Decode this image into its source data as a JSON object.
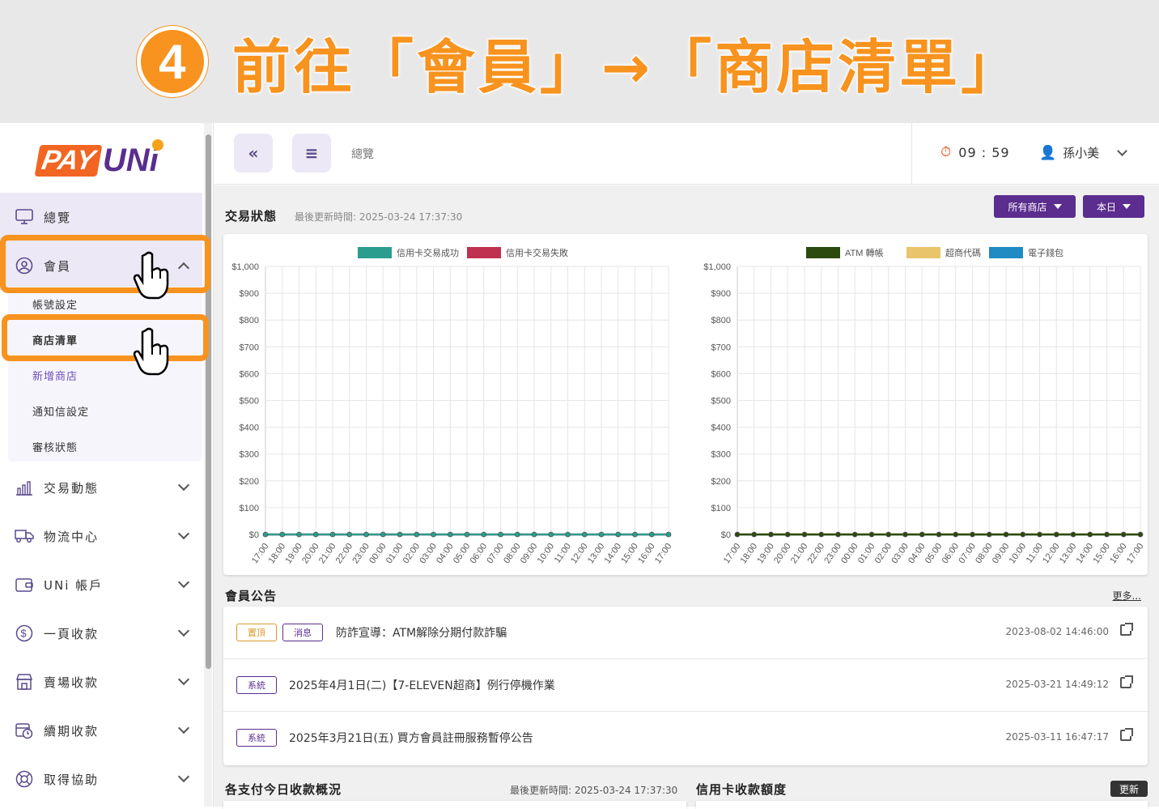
{
  "banner": {
    "step": "4",
    "text": "前往「會員」→「商店清單」"
  },
  "logo": {
    "pay": "PAY",
    "uni": "UNi"
  },
  "sidebar": {
    "overview": "總覽",
    "member": "會員",
    "member_sub": [
      "帳號設定",
      "商店清單",
      "新增商店",
      "通知信設定",
      "審核狀態"
    ],
    "items": [
      "交易動態",
      "物流中心",
      "UNi 帳戶",
      "一頁收款",
      "賣場收款",
      "續期收款",
      "取得協助"
    ]
  },
  "header": {
    "collapse_icon": "«",
    "menu_icon": "≡",
    "breadcrumb": "總覽",
    "timer": "09 : 59",
    "user": "孫小美"
  },
  "transaction": {
    "title": "交易狀態",
    "updated": "最後更新時間: 2025-03-24 17:37:30",
    "store_filter": "所有商店",
    "date_filter": "本日"
  },
  "chart_data": [
    {
      "type": "line",
      "series": [
        {
          "name": "信用卡交易成功",
          "color": "#2a9d8f",
          "values": [
            0,
            0,
            0,
            0,
            0,
            0,
            0,
            0,
            0,
            0,
            0,
            0,
            0,
            0,
            0,
            0,
            0,
            0,
            0,
            0,
            0,
            0,
            0,
            0,
            0,
            0
          ]
        },
        {
          "name": "信用卡交易失敗",
          "color": "#c0304f",
          "values": [
            0,
            0,
            0,
            0,
            0,
            0,
            0,
            0,
            0,
            0,
            0,
            0,
            0,
            0,
            0,
            0,
            0,
            0,
            0,
            0,
            0,
            0,
            0,
            0,
            0,
            0
          ]
        }
      ],
      "x": [
        "17:00",
        "18:00",
        "19:00",
        "20:00",
        "21:00",
        "22:00",
        "23:00",
        "00:00",
        "01:00",
        "02:00",
        "03:00",
        "04:00",
        "05:00",
        "06:00",
        "07:00",
        "08:00",
        "09:00",
        "10:00",
        "11:00",
        "12:00",
        "13:00",
        "14:00",
        "15:00",
        "16:00",
        "17:00"
      ],
      "y_ticks": [
        "$1,000",
        "$900",
        "$800",
        "$700",
        "$600",
        "$500",
        "$400",
        "$300",
        "$200",
        "$100",
        "$0"
      ],
      "ylim": [
        0,
        1000
      ],
      "legend": "top",
      "grid": true
    },
    {
      "type": "line",
      "series": [
        {
          "name": "ATM 轉帳",
          "color": "#2b4a0e",
          "values": [
            0,
            0,
            0,
            0,
            0,
            0,
            0,
            0,
            0,
            0,
            0,
            0,
            0,
            0,
            0,
            0,
            0,
            0,
            0,
            0,
            0,
            0,
            0,
            0,
            0
          ]
        },
        {
          "name": "超商代碼",
          "color": "#e9c46a",
          "values": [
            0,
            0,
            0,
            0,
            0,
            0,
            0,
            0,
            0,
            0,
            0,
            0,
            0,
            0,
            0,
            0,
            0,
            0,
            0,
            0,
            0,
            0,
            0,
            0,
            0
          ]
        },
        {
          "name": "電子錢包",
          "color": "#1e8bc3",
          "values": [
            0,
            0,
            0,
            0,
            0,
            0,
            0,
            0,
            0,
            0,
            0,
            0,
            0,
            0,
            0,
            0,
            0,
            0,
            0,
            0,
            0,
            0,
            0,
            0,
            0
          ]
        }
      ],
      "x": [
        "17:00",
        "18:00",
        "19:00",
        "20:00",
        "21:00",
        "22:00",
        "23:00",
        "00:00",
        "01:00",
        "02:00",
        "03:00",
        "04:00",
        "05:00",
        "06:00",
        "07:00",
        "08:00",
        "09:00",
        "10:00",
        "11:00",
        "12:00",
        "13:00",
        "14:00",
        "15:00",
        "16:00",
        "17:00"
      ],
      "y_ticks": [
        "$1,000",
        "$900",
        "$800",
        "$700",
        "$600",
        "$500",
        "$400",
        "$300",
        "$200",
        "$100",
        "$0"
      ],
      "ylim": [
        0,
        1000
      ],
      "legend": "top",
      "grid": true
    }
  ],
  "announcements": {
    "title": "會員公告",
    "more": "更多...",
    "rows": [
      {
        "tags": [
          "置頂",
          "消息"
        ],
        "title": "防詐宣導：ATM解除分期付款詐騙",
        "date": "2023-08-02 14:46:00"
      },
      {
        "tags": [
          "系統"
        ],
        "title": "2025年4月1日(二)【7-ELEVEN超商】例行停機作業",
        "date": "2025-03-21 14:49:12"
      },
      {
        "tags": [
          "系統"
        ],
        "title": "2025年3月21日(五) 買方會員註冊服務暫停公告",
        "date": "2025-03-11 16:47:17"
      }
    ]
  },
  "payments_today": {
    "title": "各支付今日收款概況",
    "updated": "最後更新時間: 2025-03-24 17:37:30"
  },
  "credit_limit": {
    "title": "信用卡收款額度",
    "refresh": "更新"
  }
}
